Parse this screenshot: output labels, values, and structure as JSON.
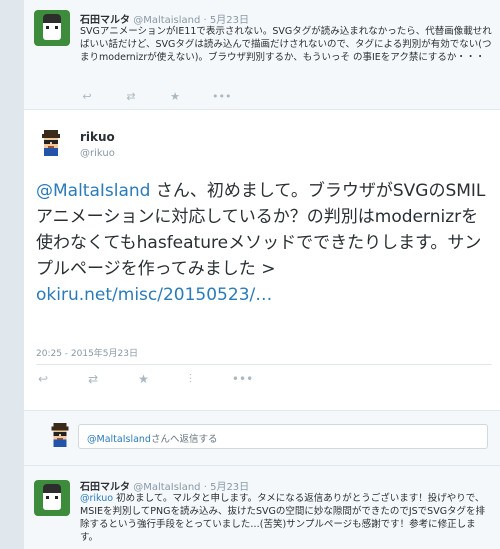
{
  "tweet1": {
    "name": "石田マルタ",
    "screen_name": "@Maltaisland",
    "date": "· 5月23日",
    "text": "SVGアニメーションがIE11で表示されない。SVGタグが読み込まれなかったら、代替画像載せればいい話だけど、SVGタグは読み込んで描画だけされないので、タグによる判別が有効でない(つまりmodernizrが使えない)。ブラウザ判別するか、もういっそ の事IEをアク禁にするか・・・"
  },
  "tweet2": {
    "name": "rikuo",
    "screen_name": "@rikuo",
    "mention": "@MaltaIsland",
    "text": " さん、初めまして。ブラウザがSVGのSMILアニメーションに対応しているか？の判別はmodernizrを使わなくてもhasfeatureメソッドでできたりします。サンプルページを作ってみました > ",
    "link": "okiru.net/misc/20150523/…",
    "timestamp": "20:25 - 2015年5月23日"
  },
  "reply": {
    "mention": "@MaltaIsland",
    "placeholder": "さんへ返信する"
  },
  "tweet3": {
    "name": "石田マルタ",
    "screen_name": "@MaltaIsland",
    "date": "· 5月23日",
    "mention": "@rikuo",
    "text": " 初めまして。マルタと申します。タメになる返信ありがとうございます！投げやりで、MSIEを判別してPNGを読み込み、抜けたSVGの空間に妙な隙間ができたのでJSでSVGタグを排除するという強行手段をとっていました…(苦笑)サンプルページも感謝です！参考に修正します。"
  },
  "icons": {
    "reply": "↩",
    "retweet": "⇄",
    "favorite": "★",
    "more": "•••",
    "stats": "⫶"
  }
}
